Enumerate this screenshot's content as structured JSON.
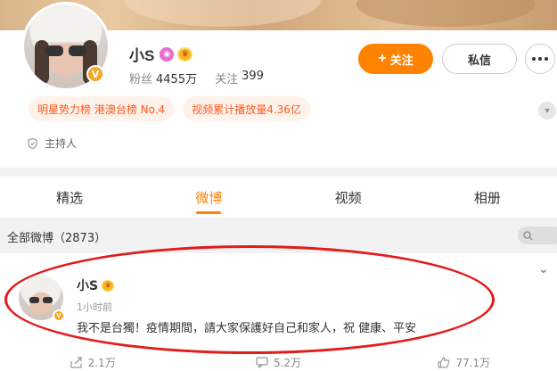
{
  "profile": {
    "name": "小S",
    "fans_label": "粉丝",
    "fans_count": "4455万",
    "following_label": "关注",
    "following_count": "399",
    "follow_button": "关注",
    "message_button": "私信",
    "tags": [
      "明星势力榜 港澳台榜 No.4",
      "视频累计播放量4.36亿"
    ],
    "role": "主持人",
    "verified_badge": "V"
  },
  "tabs": [
    {
      "label": "精选",
      "active": false
    },
    {
      "label": "微博",
      "active": true
    },
    {
      "label": "视频",
      "active": false
    },
    {
      "label": "相册",
      "active": false
    }
  ],
  "feed": {
    "title": "全部微博（2873）"
  },
  "post": {
    "author": "小S",
    "time": "1小时前",
    "text": "我不是台獨！疫情期間，請大家保護好自己和家人，祝 健康、平安",
    "repost_count": "2.1万",
    "comment_count": "5.2万",
    "like_count": "77.1万"
  },
  "colors": {
    "accent": "#ff8200",
    "tag_text": "#ff5a1f",
    "tag_bg": "#fff2ea",
    "highlight": "#e31b1b"
  },
  "icons": [
    "more-dots-icon",
    "shield-icon",
    "chevron-down-icon",
    "search-icon",
    "repost-icon",
    "comment-icon",
    "like-icon"
  ]
}
